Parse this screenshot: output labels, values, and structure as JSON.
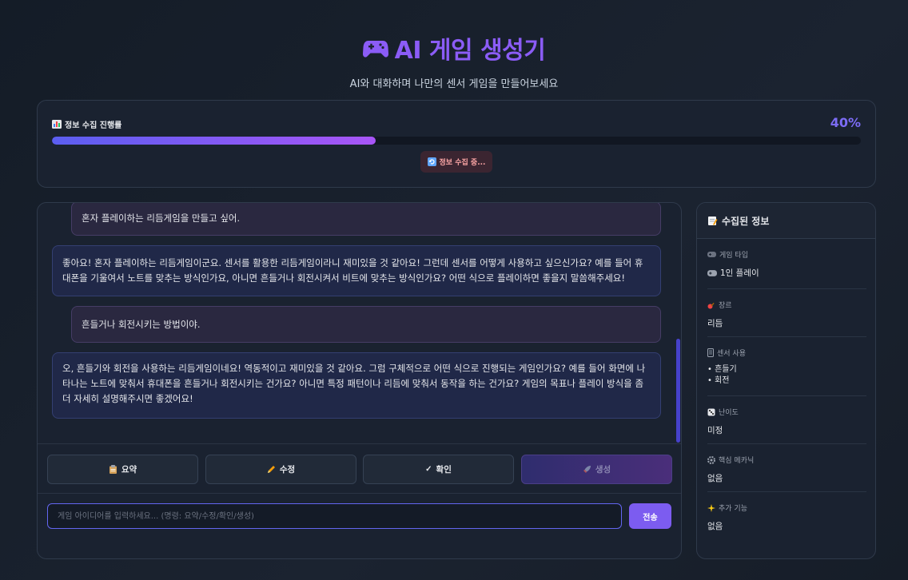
{
  "header": {
    "title": "AI 게임 생성기",
    "subtitle": "AI와 대화하며 나만의 센서 게임을 만들어보세요"
  },
  "progress": {
    "label": "정보 수집 진행률",
    "percent_text": "40%",
    "fraction": 0.4,
    "status": "정보 수집 중..."
  },
  "messages": [
    {
      "role": "user",
      "text": "혼자 플레이하는 리듬게임을 만들고 싶어."
    },
    {
      "role": "ai",
      "text": "좋아요! 혼자 플레이하는 리듬게임이군요. 센서를 활용한 리듬게임이라니 재미있을 것 같아요! 그런데 센서를 어떻게 사용하고 싶으신가요? 예를 들어 휴대폰을 기울여서 노트를 맞추는 방식인가요, 아니면 흔들거나 회전시켜서 비트에 맞추는 방식인가요? 어떤 식으로 플레이하면 좋을지 말씀해주세요!"
    },
    {
      "role": "user",
      "text": "흔들거나 회전시키는 방법이야."
    },
    {
      "role": "ai",
      "text": "오, 흔들기와 회전을 사용하는 리듬게임이네요! 역동적이고 재미있을 것 같아요. 그럼 구체적으로 어떤 식으로 진행되는 게임인가요? 예를 들어 화면에 나타나는 노트에 맞춰서 휴대폰을 흔들거나 회전시키는 건가요? 아니면 특정 패턴이나 리듬에 맞춰서 동작을 하는 건가요? 게임의 목표나 플레이 방식을 좀 더 자세히 설명해주시면 좋겠어요!"
    }
  ],
  "actions": {
    "summary": "요약",
    "edit": "수정",
    "confirm": "확인",
    "generate": "생성"
  },
  "input": {
    "placeholder": "게임 아이디어를 입력하세요... (명령: 요약/수정/확인/생성)",
    "send_label": "전송"
  },
  "info": {
    "title": "수집된 정보",
    "game_type": {
      "label": "게임 타입",
      "value": "1인 플레이"
    },
    "genre": {
      "label": "장르",
      "value": "리듬"
    },
    "sensors": {
      "label": "센서 사용",
      "items": [
        "• 흔들기",
        "• 회전"
      ]
    },
    "difficulty": {
      "label": "난이도",
      "value": "미정"
    },
    "mechanics": {
      "label": "핵심 메카닉",
      "value": "없음"
    },
    "features": {
      "label": "추가 기능",
      "value": "없음"
    }
  },
  "colors": {
    "accent": "#8b5cf6",
    "progress_start": "#5b5ef0",
    "progress_end": "#a855f7",
    "background": "#161d28"
  },
  "icons": [
    "gamepad-icon",
    "bar-chart-icon",
    "refresh-icon",
    "clipboard-icon",
    "pencil-icon",
    "check-icon",
    "rocket-icon",
    "memo-icon",
    "guitar-icon",
    "phone-icon",
    "dice-icon",
    "gear-icon",
    "sparkles-icon"
  ]
}
